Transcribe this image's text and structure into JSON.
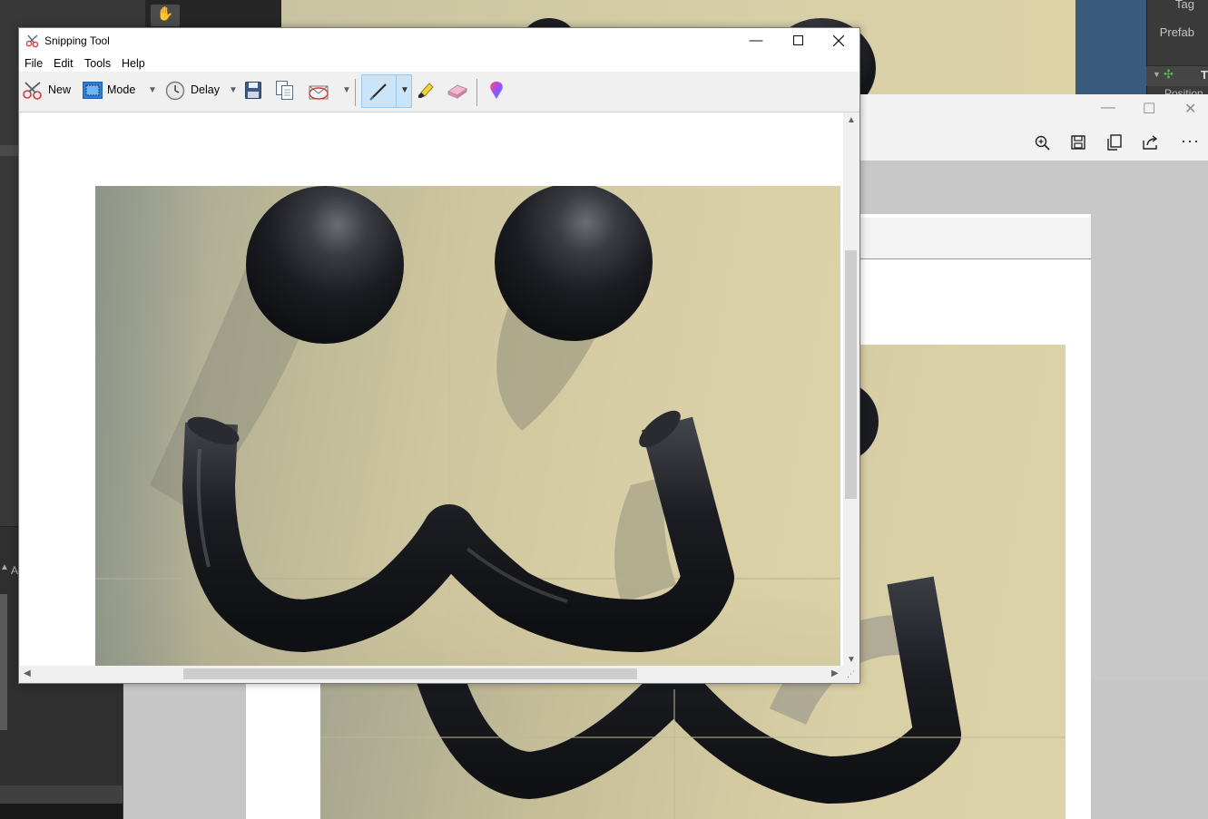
{
  "snipping_tool": {
    "title": "Snipping Tool",
    "menu": [
      "File",
      "Edit",
      "Tools",
      "Help"
    ],
    "toolbar": {
      "new_label": "New",
      "mode_label": "Mode",
      "delay_label": "Delay"
    },
    "active_tool": "pen",
    "icons": {
      "new": "scissors-icon",
      "mode": "rectangle-snip-icon",
      "delay": "clock-icon",
      "save": "save-icon",
      "copy": "copy-icon",
      "send": "send-email-icon",
      "pen": "pen-icon",
      "highlighter": "highlighter-icon",
      "eraser": "eraser-icon",
      "paint3d": "paint-3d-icon"
    },
    "colors": {
      "titlebar": "#ffffff",
      "toolbar": "#f0f0f0",
      "active_tool_bg": "#cce4f7"
    }
  },
  "background": {
    "inspector": {
      "tag_label": "Tag",
      "prefab_label": "Prefab",
      "section_label": "T",
      "position_label": "Position"
    },
    "left_panel_label": "A",
    "viewer_icons": [
      "zoom-in-icon",
      "save-icon",
      "copy-icon",
      "share-icon",
      "more-icon"
    ]
  }
}
